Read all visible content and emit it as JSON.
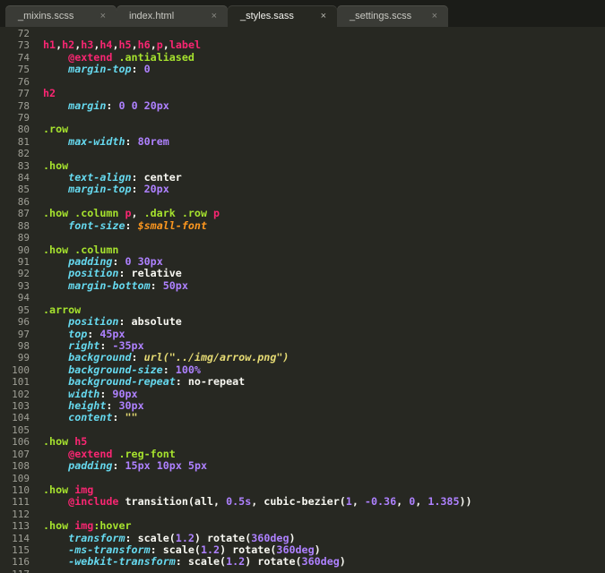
{
  "tabs": [
    {
      "label": "_mixins.scss",
      "close": "×",
      "active": false
    },
    {
      "label": "index.html",
      "close": "×",
      "active": false
    },
    {
      "label": "_styles.sass",
      "close": "×",
      "active": true
    },
    {
      "label": "_settings.scss",
      "close": "×",
      "active": false
    }
  ],
  "colors": {
    "background": "#272822",
    "selector": "#a6e22e",
    "tag": "#f92672",
    "property": "#66d9ef",
    "number": "#ae81ff",
    "string": "#e6db74",
    "variable": "#fd971f",
    "text": "#f8f8f2"
  },
  "lines": [
    {
      "n": "72",
      "tokens": []
    },
    {
      "n": "73",
      "tokens": [
        [
          "tag",
          "h1"
        ],
        [
          "plain",
          ","
        ],
        [
          "tag",
          "h2"
        ],
        [
          "plain",
          ","
        ],
        [
          "tag",
          "h3"
        ],
        [
          "plain",
          ","
        ],
        [
          "tag",
          "h4"
        ],
        [
          "plain",
          ","
        ],
        [
          "tag",
          "h5"
        ],
        [
          "plain",
          ","
        ],
        [
          "tag",
          "h6"
        ],
        [
          "plain",
          ","
        ],
        [
          "tag",
          "p"
        ],
        [
          "plain",
          ","
        ],
        [
          "tag",
          "label"
        ]
      ]
    },
    {
      "n": "74",
      "tokens": [
        [
          "plain",
          "    "
        ],
        [
          "kw",
          "@extend"
        ],
        [
          "plain",
          " "
        ],
        [
          "sel",
          ".antialiased"
        ]
      ]
    },
    {
      "n": "75",
      "tokens": [
        [
          "plain",
          "    "
        ],
        [
          "prop",
          "margin-top"
        ],
        [
          "plain",
          ": "
        ],
        [
          "num",
          "0"
        ]
      ]
    },
    {
      "n": "76",
      "tokens": []
    },
    {
      "n": "77",
      "tokens": [
        [
          "tag",
          "h2"
        ]
      ]
    },
    {
      "n": "78",
      "tokens": [
        [
          "plain",
          "    "
        ],
        [
          "prop",
          "margin"
        ],
        [
          "plain",
          ": "
        ],
        [
          "num",
          "0"
        ],
        [
          "plain",
          " "
        ],
        [
          "num",
          "0"
        ],
        [
          "plain",
          " "
        ],
        [
          "num",
          "20px"
        ]
      ]
    },
    {
      "n": "79",
      "tokens": []
    },
    {
      "n": "80",
      "tokens": [
        [
          "sel",
          ".row"
        ]
      ]
    },
    {
      "n": "81",
      "tokens": [
        [
          "plain",
          "    "
        ],
        [
          "prop",
          "max-width"
        ],
        [
          "plain",
          ": "
        ],
        [
          "num",
          "80rem"
        ]
      ]
    },
    {
      "n": "82",
      "tokens": []
    },
    {
      "n": "83",
      "tokens": [
        [
          "sel",
          ".how"
        ]
      ]
    },
    {
      "n": "84",
      "tokens": [
        [
          "plain",
          "    "
        ],
        [
          "prop",
          "text-align"
        ],
        [
          "plain",
          ": center"
        ]
      ]
    },
    {
      "n": "85",
      "tokens": [
        [
          "plain",
          "    "
        ],
        [
          "prop",
          "margin-top"
        ],
        [
          "plain",
          ": "
        ],
        [
          "num",
          "20px"
        ]
      ]
    },
    {
      "n": "86",
      "tokens": []
    },
    {
      "n": "87",
      "tokens": [
        [
          "sel",
          ".how .column "
        ],
        [
          "tag",
          "p"
        ],
        [
          "plain",
          ", "
        ],
        [
          "sel",
          ".dark .row "
        ],
        [
          "tag",
          "p"
        ]
      ]
    },
    {
      "n": "88",
      "tokens": [
        [
          "plain",
          "    "
        ],
        [
          "prop",
          "font-size"
        ],
        [
          "plain",
          ": "
        ],
        [
          "var",
          "$small-font"
        ]
      ]
    },
    {
      "n": "89",
      "tokens": []
    },
    {
      "n": "90",
      "tokens": [
        [
          "sel",
          ".how .column"
        ]
      ]
    },
    {
      "n": "91",
      "tokens": [
        [
          "plain",
          "    "
        ],
        [
          "prop",
          "padding"
        ],
        [
          "plain",
          ": "
        ],
        [
          "num",
          "0"
        ],
        [
          "plain",
          " "
        ],
        [
          "num",
          "30px"
        ]
      ]
    },
    {
      "n": "92",
      "tokens": [
        [
          "plain",
          "    "
        ],
        [
          "prop",
          "position"
        ],
        [
          "plain",
          ": relative"
        ]
      ]
    },
    {
      "n": "93",
      "tokens": [
        [
          "plain",
          "    "
        ],
        [
          "prop",
          "margin-bottom"
        ],
        [
          "plain",
          ": "
        ],
        [
          "num",
          "50px"
        ]
      ]
    },
    {
      "n": "94",
      "tokens": []
    },
    {
      "n": "95",
      "tokens": [
        [
          "sel",
          ".arrow"
        ]
      ]
    },
    {
      "n": "96",
      "tokens": [
        [
          "plain",
          "    "
        ],
        [
          "prop",
          "position"
        ],
        [
          "plain",
          ": absolute"
        ]
      ]
    },
    {
      "n": "97",
      "tokens": [
        [
          "plain",
          "    "
        ],
        [
          "prop",
          "top"
        ],
        [
          "plain",
          ": "
        ],
        [
          "num",
          "45px"
        ]
      ]
    },
    {
      "n": "98",
      "tokens": [
        [
          "plain",
          "    "
        ],
        [
          "prop",
          "right"
        ],
        [
          "plain",
          ": "
        ],
        [
          "num",
          "-35px"
        ]
      ]
    },
    {
      "n": "99",
      "tokens": [
        [
          "plain",
          "    "
        ],
        [
          "prop",
          "background"
        ],
        [
          "plain",
          ": "
        ],
        [
          "str",
          "url(\"../img/arrow.png\")"
        ]
      ]
    },
    {
      "n": "100",
      "tokens": [
        [
          "plain",
          "    "
        ],
        [
          "prop",
          "background-size"
        ],
        [
          "plain",
          ": "
        ],
        [
          "num",
          "100%"
        ]
      ]
    },
    {
      "n": "101",
      "tokens": [
        [
          "plain",
          "    "
        ],
        [
          "prop",
          "background-repeat"
        ],
        [
          "plain",
          ": no-repeat"
        ]
      ]
    },
    {
      "n": "102",
      "tokens": [
        [
          "plain",
          "    "
        ],
        [
          "prop",
          "width"
        ],
        [
          "plain",
          ": "
        ],
        [
          "num",
          "90px"
        ]
      ]
    },
    {
      "n": "103",
      "tokens": [
        [
          "plain",
          "    "
        ],
        [
          "prop",
          "height"
        ],
        [
          "plain",
          ": "
        ],
        [
          "num",
          "30px"
        ]
      ]
    },
    {
      "n": "104",
      "tokens": [
        [
          "plain",
          "    "
        ],
        [
          "prop",
          "content"
        ],
        [
          "plain",
          ": "
        ],
        [
          "str",
          "\"\""
        ]
      ]
    },
    {
      "n": "105",
      "tokens": []
    },
    {
      "n": "106",
      "tokens": [
        [
          "sel",
          ".how "
        ],
        [
          "tag",
          "h5"
        ]
      ]
    },
    {
      "n": "107",
      "tokens": [
        [
          "plain",
          "    "
        ],
        [
          "kw",
          "@extend"
        ],
        [
          "plain",
          " "
        ],
        [
          "sel",
          ".reg-font"
        ]
      ]
    },
    {
      "n": "108",
      "tokens": [
        [
          "plain",
          "    "
        ],
        [
          "prop",
          "padding"
        ],
        [
          "plain",
          ": "
        ],
        [
          "num",
          "15px"
        ],
        [
          "plain",
          " "
        ],
        [
          "num",
          "10px"
        ],
        [
          "plain",
          " "
        ],
        [
          "num",
          "5px"
        ]
      ]
    },
    {
      "n": "109",
      "tokens": []
    },
    {
      "n": "110",
      "tokens": [
        [
          "sel",
          ".how "
        ],
        [
          "tag",
          "img"
        ]
      ]
    },
    {
      "n": "111",
      "tokens": [
        [
          "plain",
          "    "
        ],
        [
          "kw",
          "@include"
        ],
        [
          "plain",
          " transition(all, "
        ],
        [
          "num",
          "0.5s"
        ],
        [
          "plain",
          ", cubic-bezier("
        ],
        [
          "num",
          "1"
        ],
        [
          "plain",
          ", "
        ],
        [
          "num",
          "-0.36"
        ],
        [
          "plain",
          ", "
        ],
        [
          "num",
          "0"
        ],
        [
          "plain",
          ", "
        ],
        [
          "num",
          "1.385"
        ],
        [
          "plain",
          "))"
        ]
      ]
    },
    {
      "n": "112",
      "tokens": []
    },
    {
      "n": "113",
      "tokens": [
        [
          "sel",
          ".how "
        ],
        [
          "tag",
          "img"
        ],
        [
          "sel",
          ":hover"
        ]
      ]
    },
    {
      "n": "114",
      "tokens": [
        [
          "plain",
          "    "
        ],
        [
          "prop",
          "transform"
        ],
        [
          "plain",
          ": scale("
        ],
        [
          "num",
          "1.2"
        ],
        [
          "plain",
          ") rotate("
        ],
        [
          "num",
          "360deg"
        ],
        [
          "plain",
          ")"
        ]
      ]
    },
    {
      "n": "115",
      "tokens": [
        [
          "plain",
          "    "
        ],
        [
          "prop",
          "-ms-transform"
        ],
        [
          "plain",
          ": scale("
        ],
        [
          "num",
          "1.2"
        ],
        [
          "plain",
          ") rotate("
        ],
        [
          "num",
          "360deg"
        ],
        [
          "plain",
          ")"
        ]
      ]
    },
    {
      "n": "116",
      "tokens": [
        [
          "plain",
          "    "
        ],
        [
          "prop",
          "-webkit-transform"
        ],
        [
          "plain",
          ": scale("
        ],
        [
          "num",
          "1.2"
        ],
        [
          "plain",
          ") rotate("
        ],
        [
          "num",
          "360deg"
        ],
        [
          "plain",
          ")"
        ]
      ]
    },
    {
      "n": "117",
      "tokens": []
    }
  ]
}
